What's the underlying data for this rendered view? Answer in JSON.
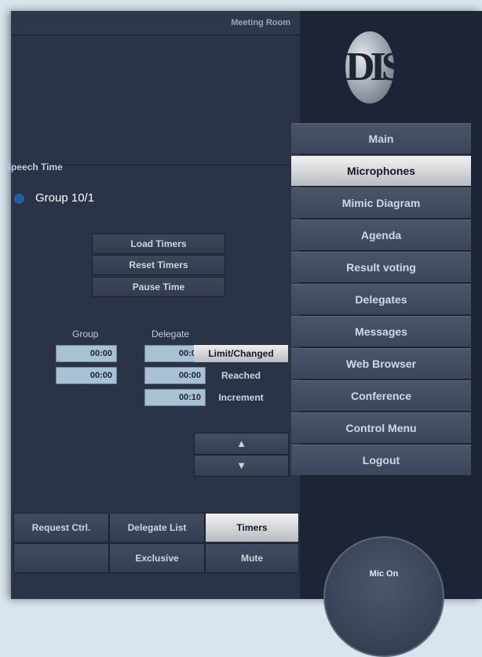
{
  "header": {
    "room_title": "Meeting Room"
  },
  "logo": {
    "text": "DIS"
  },
  "nav": {
    "items": [
      {
        "label": "Main"
      },
      {
        "label": "Microphones",
        "active": true
      },
      {
        "label": "Mimic Diagram"
      },
      {
        "label": "Agenda"
      },
      {
        "label": "Result voting"
      },
      {
        "label": "Delegates"
      },
      {
        "label": "Messages"
      },
      {
        "label": "Web Browser"
      },
      {
        "label": "Conference"
      },
      {
        "label": "Control Menu"
      },
      {
        "label": "Logout"
      }
    ]
  },
  "speech_time": {
    "section_label": "Speech Time",
    "group_name": "Group 10/1",
    "buttons": {
      "load_timers": "Load Timers",
      "reset_timers": "Reset Timers",
      "pause_time": "Pause Time"
    },
    "columns": {
      "group": "Group",
      "delegate": "Delegate"
    },
    "rows": [
      {
        "group_value": "00:00",
        "delegate_value": "00:00",
        "label": "Limit/Changed",
        "active": true
      },
      {
        "group_value": "00:00",
        "delegate_value": "00:00",
        "label": "Reached"
      },
      {
        "delegate_value": "00:10",
        "label": "Increment"
      }
    ],
    "arrows": {
      "up": "▲",
      "down": "▼"
    }
  },
  "bottom_bar": {
    "request_ctrl": "Request Ctrl.",
    "delegate_list": "Delegate List",
    "timers": "Timers",
    "exclusive": "Exclusive",
    "mute": "Mute"
  },
  "mic_button": {
    "label": "Mic On"
  },
  "colors": {
    "background": "#2a3446",
    "right_panel": "#1d2535",
    "time_box": "#a8c1d4",
    "group_dot": "#1f5ea8",
    "active_button": "#e6e6e6"
  }
}
